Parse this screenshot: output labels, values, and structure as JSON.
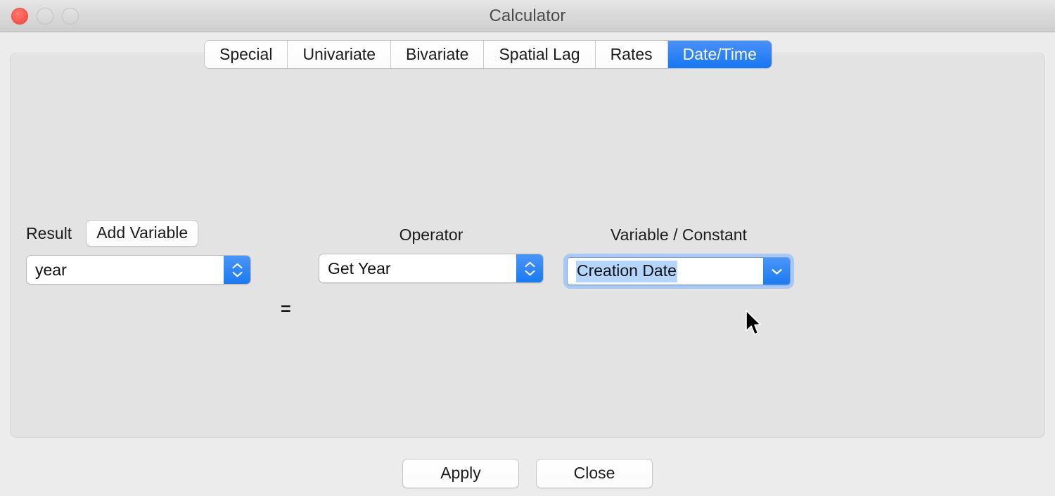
{
  "window": {
    "title": "Calculator",
    "traffic_lights": [
      {
        "name": "close",
        "color": "#fa5b4f"
      },
      {
        "name": "minimize",
        "color": "#d9d9d9"
      },
      {
        "name": "zoom",
        "color": "#d9d9d9"
      }
    ]
  },
  "tabs": {
    "selected": "Date/Time",
    "selected_color": "#1777f2",
    "items": [
      {
        "label": "Special",
        "selected": false
      },
      {
        "label": "Univariate",
        "selected": false
      },
      {
        "label": "Bivariate",
        "selected": false
      },
      {
        "label": "Spatial Lag",
        "selected": false
      },
      {
        "label": "Rates",
        "selected": false
      },
      {
        "label": "Date/Time",
        "selected": true
      }
    ]
  },
  "form": {
    "result": {
      "label": "Result",
      "add_variable_button": "Add Variable",
      "combo_value": "year"
    },
    "equals": "=",
    "operator": {
      "label": "Operator",
      "combo_value": "Get Year"
    },
    "variable": {
      "label": "Variable / Constant",
      "combo_value": "Creation Date",
      "selected_text": "Creation Date",
      "selection_highlight_color": "#b4d5fc",
      "focus_ring_color": "#a8c8f5"
    }
  },
  "footer": {
    "apply_label": "Apply",
    "close_label": "Close"
  }
}
